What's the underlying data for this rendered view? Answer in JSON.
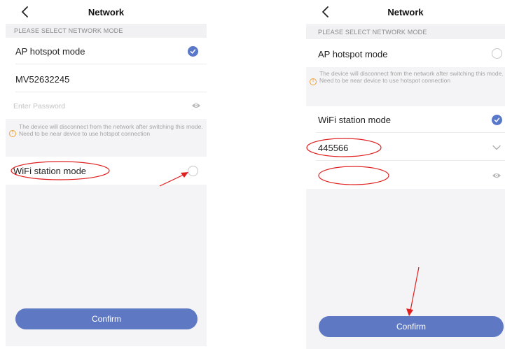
{
  "left_screen": {
    "header": {
      "title": "Network",
      "back_icon": "chevron-left-icon"
    },
    "section_label": "PLEASE SELECT NETWORK MODE",
    "ap_mode": {
      "label": "AP hotspot mode",
      "selected": true
    },
    "ssid_value": "MV52632245",
    "password": {
      "placeholder": "Enter Password",
      "icon": "eye-icon"
    },
    "notice": {
      "icon": "warning-icon",
      "text": "The device will disconnect from the network after switching this mode. Need to be near device to use hotspot connection"
    },
    "wifi_mode": {
      "label": "WiFi station mode",
      "selected": false
    },
    "confirm_label": "Confirm"
  },
  "right_screen": {
    "header": {
      "title": "Network",
      "back_icon": "chevron-left-icon"
    },
    "section_label": "PLEASE SELECT NETWORK MODE",
    "ap_mode": {
      "label": "AP hotspot mode",
      "selected": false
    },
    "notice": {
      "icon": "warning-icon",
      "text": "The device will disconnect from the network after switching this mode. Need to be near device to use hotspot connection"
    },
    "wifi_mode": {
      "label": "WiFi station mode",
      "selected": true
    },
    "ssid_value": "445566",
    "ssid_icon": "chevron-down-icon",
    "password": {
      "icon": "eye-icon"
    },
    "confirm_label": "Confirm"
  },
  "colors": {
    "accent": "#5a78ca",
    "button": "#5f78c4",
    "annotation": "#e02020",
    "warning": "#f0a23a"
  }
}
